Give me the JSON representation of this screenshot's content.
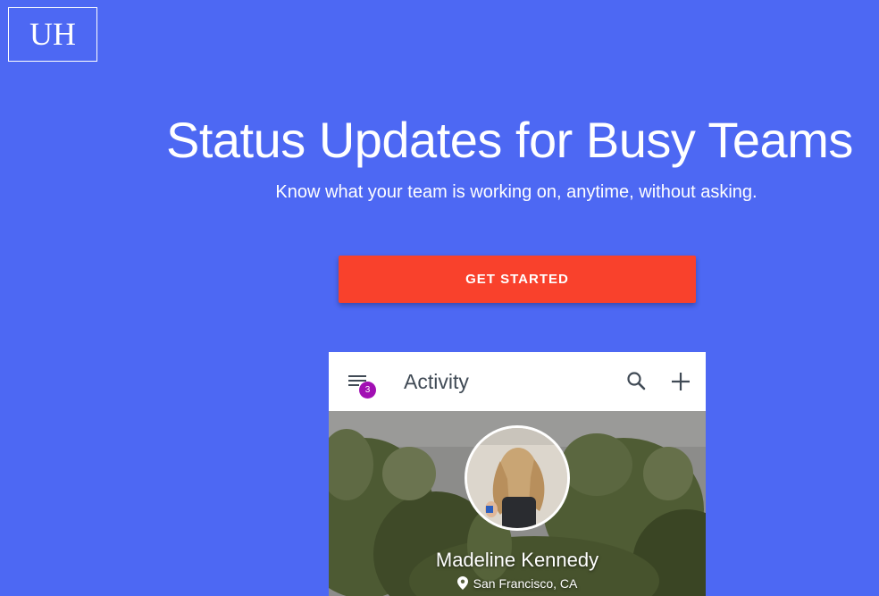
{
  "logo": {
    "text": "UH"
  },
  "hero": {
    "title": "Status Updates for Busy Teams",
    "subtitle": "Know what your team is working on, anytime, without asking."
  },
  "cta": {
    "label": "GET STARTED"
  },
  "app": {
    "menu_badge": "3",
    "title": "Activity",
    "icons": {
      "menu": "menu-icon",
      "search": "search-icon",
      "add": "add-icon",
      "location": "location-pin-icon"
    },
    "profile": {
      "name": "Madeline Kennedy",
      "location": "San Francisco, CA"
    }
  },
  "colors": {
    "background": "#4d68f3",
    "cta": "#f9412c",
    "badge": "#a10fb3",
    "appbar_text": "#404a55"
  }
}
